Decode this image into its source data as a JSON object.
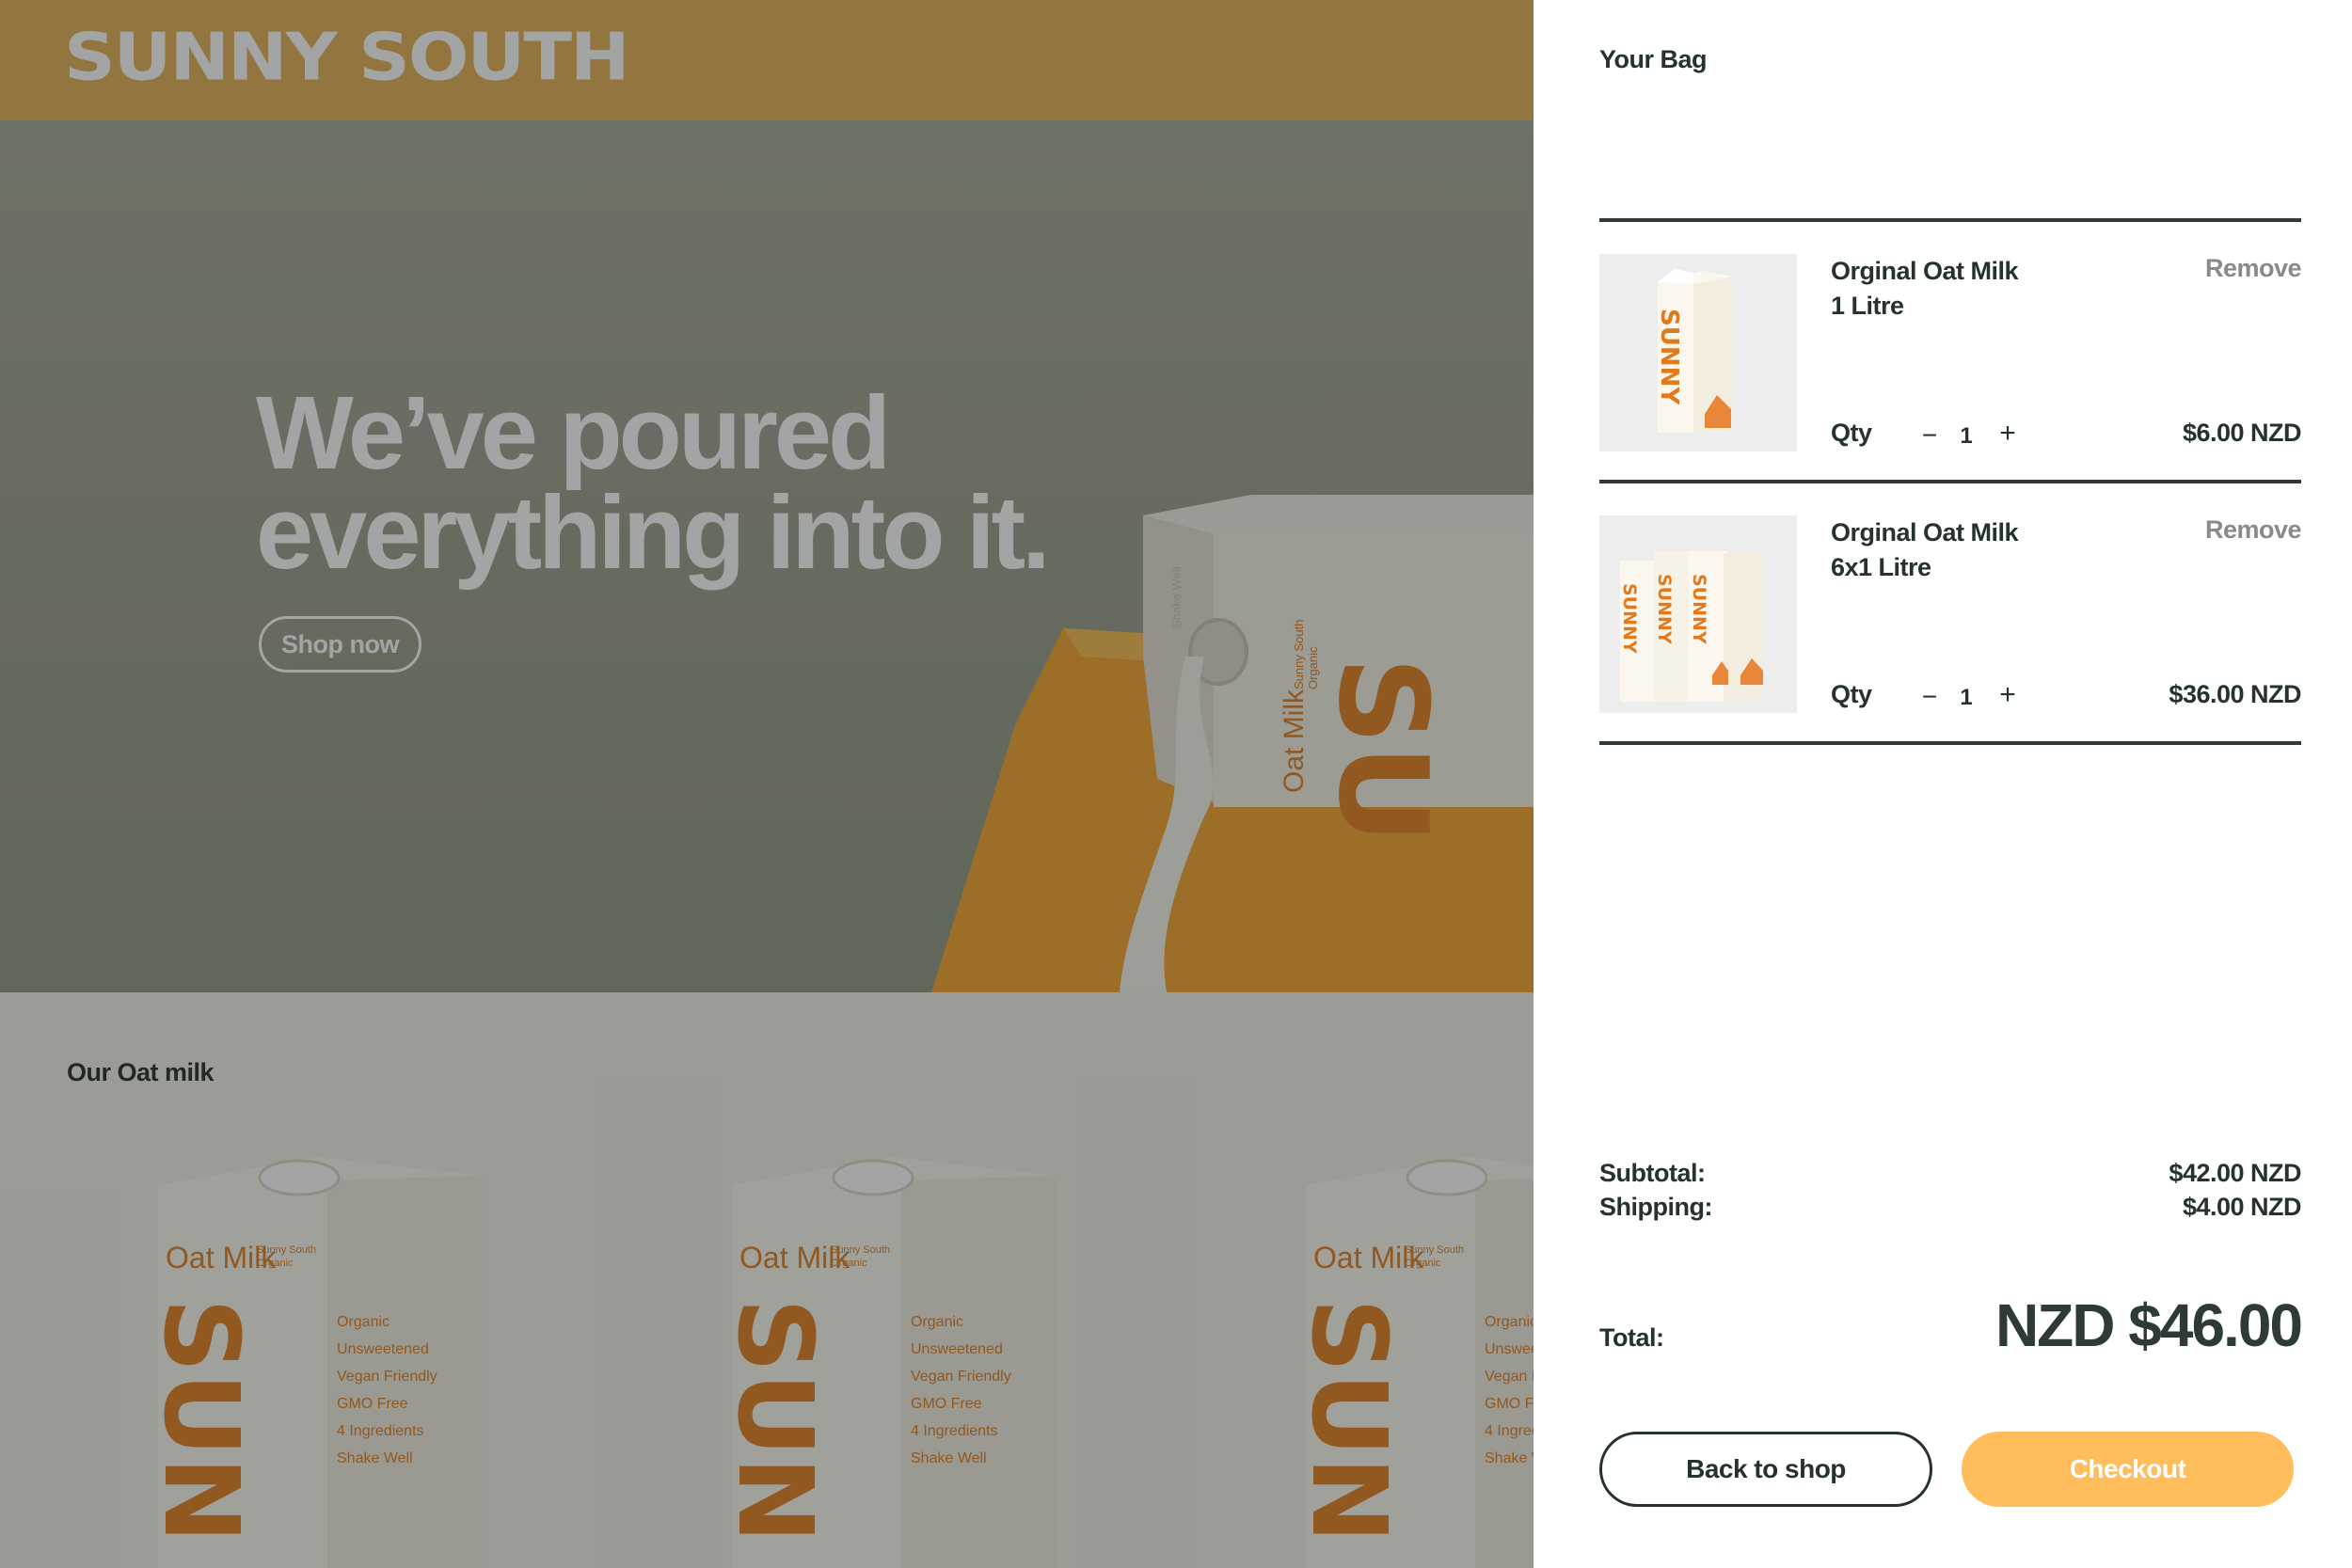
{
  "store": {
    "brand": "SUNNY SOUTH",
    "hero": {
      "title": "We’ve poured\neverything into it.",
      "cta_label": "Shop now",
      "carton_side_text": "Oat Milk",
      "carton_brand_text": "Sunny South",
      "carton_brand_sub": "Organic",
      "carton_big_text": "SU",
      "carton_top_text": "Shake Well"
    },
    "products": {
      "heading": "Our Oat milk",
      "carton_title": "Oat Milk",
      "carton_brand": "Sunny South",
      "carton_brand_sub": "Organic",
      "carton_big_text": "SUN",
      "carton_features": [
        "Organic",
        "Unsweetened",
        "Vegan Friendly",
        "GMO Free",
        "4 Ingredients",
        "Shake Well"
      ]
    }
  },
  "cart": {
    "title": "Your Bag",
    "items": [
      {
        "name": "Orginal Oat Milk\n1 Litre",
        "remove_label": "Remove",
        "qty_label": "Qty",
        "qty": "1",
        "price": "$6.00 NZD",
        "thumb_text": "SUNNY"
      },
      {
        "name": "Orginal Oat Milk\n6x1 Litre",
        "remove_label": "Remove",
        "qty_label": "Qty",
        "qty": "1",
        "price": "$36.00 NZD",
        "thumb_text": "SUNNY"
      }
    ],
    "summary": {
      "subtotal_label": "Subtotal:",
      "subtotal_value": "$42.00 NZD",
      "shipping_label": "Shipping:",
      "shipping_value": "$4.00 NZD",
      "total_label": "Total:",
      "total_value": "NZD $46.00"
    },
    "buttons": {
      "back_label": "Back to shop",
      "checkout_label": "Checkout"
    }
  },
  "colors": {
    "brand_yellow": "#e3ac51",
    "accent_orange": "#e07a1c",
    "checkout": "#ffbd5c",
    "text_dark": "#26322c"
  }
}
